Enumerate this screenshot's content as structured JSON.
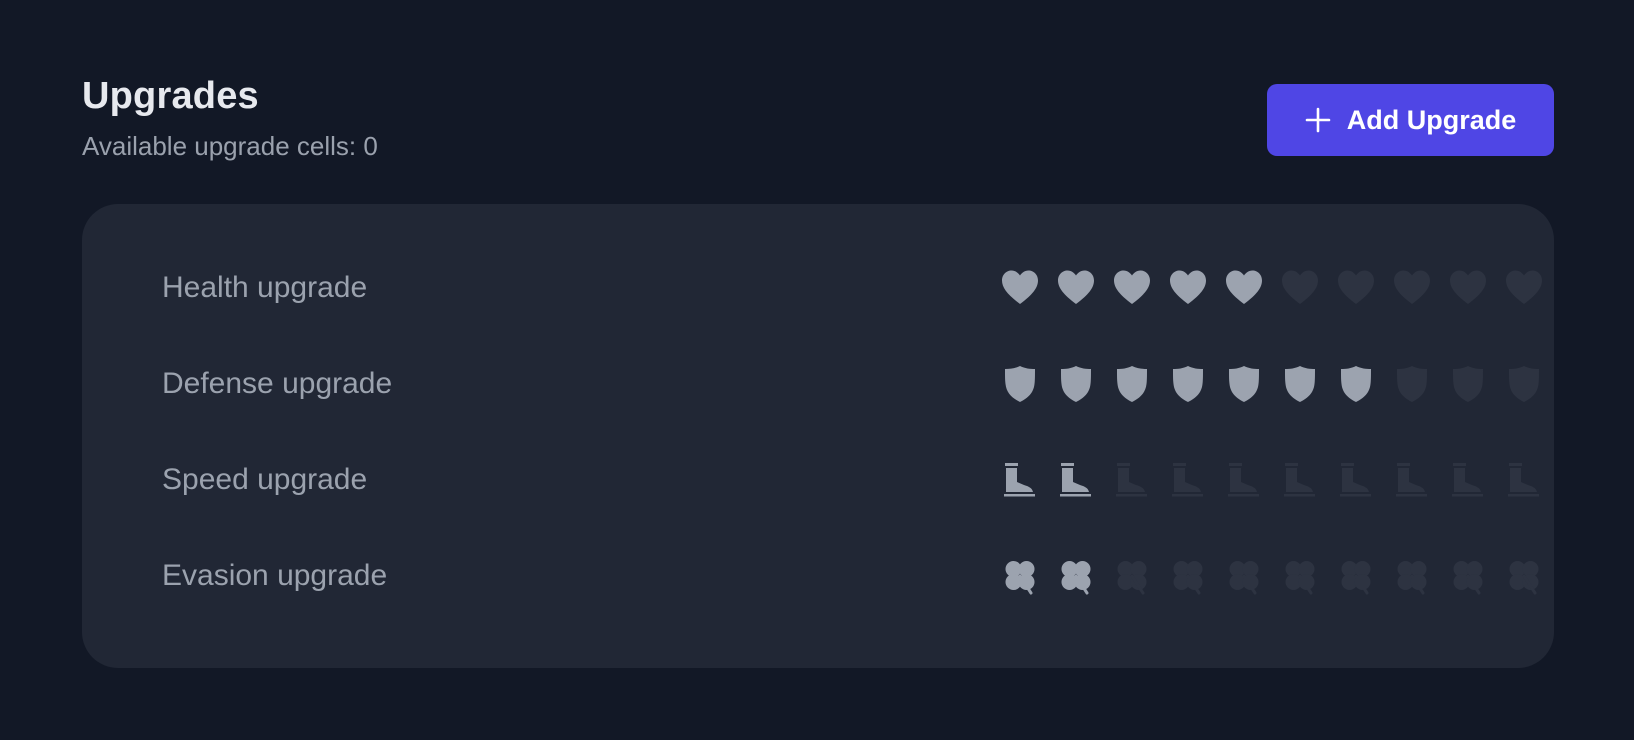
{
  "header": {
    "title": "Upgrades",
    "subtitle": "Available upgrade cells: 0"
  },
  "add_button": {
    "label": "Add Upgrade",
    "icon": "plus-icon"
  },
  "colors": {
    "background": "#121826",
    "card": "#212735",
    "accent": "#4f46e5",
    "filled": "#9ca3af",
    "empty": "#2d3341"
  },
  "upgrades": [
    {
      "label": "Health upgrade",
      "icon": "heart-icon",
      "filled": 5,
      "total": 10
    },
    {
      "label": "Defense upgrade",
      "icon": "shield-icon",
      "filled": 7,
      "total": 10
    },
    {
      "label": "Speed upgrade",
      "icon": "boot-icon",
      "filled": 2,
      "total": 10
    },
    {
      "label": "Evasion upgrade",
      "icon": "clover-icon",
      "filled": 2,
      "total": 10
    }
  ]
}
